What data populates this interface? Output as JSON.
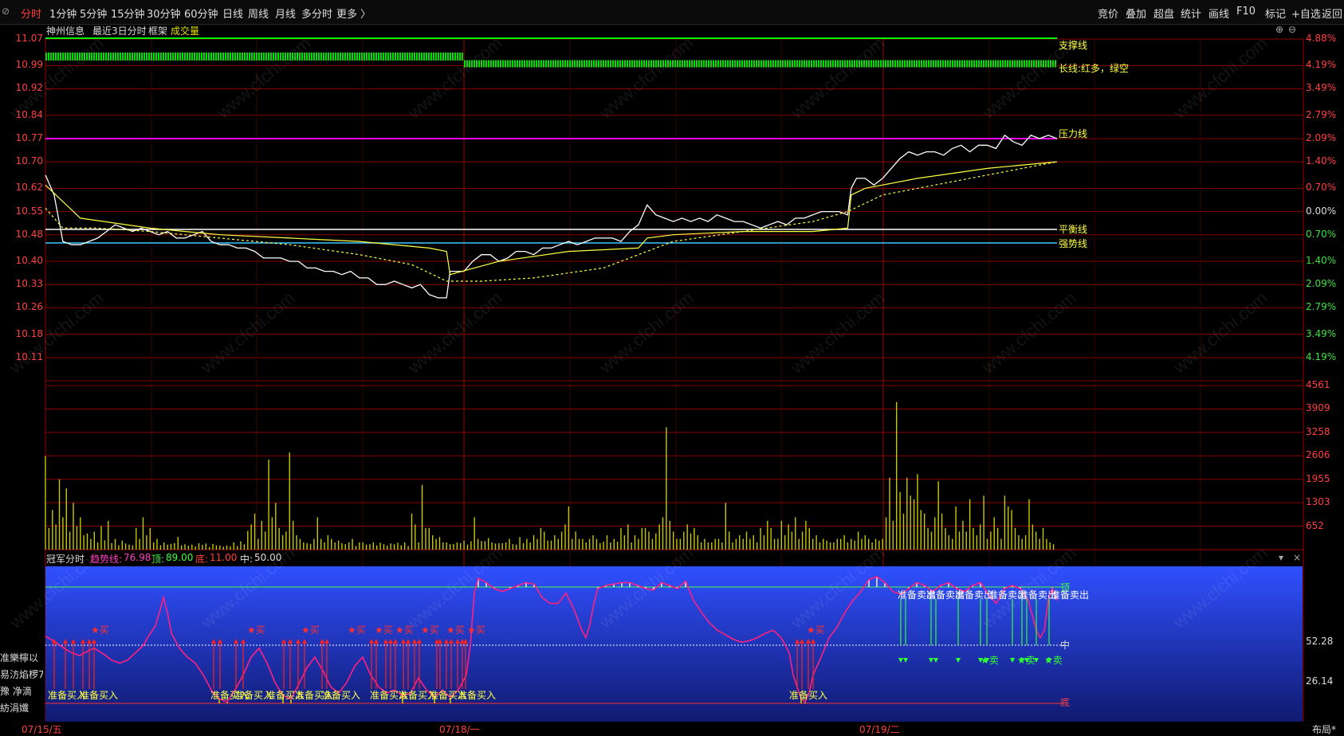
{
  "toolbar": {
    "left_icon": "⊘",
    "periods": [
      "分时",
      "1分钟",
      "5分钟",
      "15分钟",
      "30分钟",
      "60分钟",
      "日线",
      "周线",
      "月线",
      "多分时",
      "更多 〉"
    ],
    "active_period": "分时",
    "right_buttons": [
      "竞价",
      "叠加",
      "超盘",
      "统计",
      "画线",
      "F10",
      "标记",
      "+自选",
      "返回"
    ]
  },
  "info": {
    "stock": "神州信息",
    "range": "最近3日分时",
    "frame": "框架",
    "volume_label": "成交量"
  },
  "price_axis": {
    "left": [
      "11.07",
      "10.99",
      "10.92",
      "10.84",
      "10.77",
      "10.70",
      "10.62",
      "10.55",
      "10.48",
      "10.40",
      "10.33",
      "10.26",
      "10.18",
      "10.11"
    ],
    "right": [
      "4.88%",
      "4.19%",
      "3.49%",
      "2.79%",
      "2.09%",
      "1.40%",
      "0.70%",
      "0.00%",
      "0.70%",
      "1.40%",
      "2.09%",
      "2.79%",
      "3.49%",
      "4.19%"
    ]
  },
  "volume_axis": [
    "4561",
    "3909",
    "3258",
    "2606",
    "1955",
    "1303",
    "652"
  ],
  "line_labels": {
    "support": "支撑线",
    "long": "长线:红多，绿空",
    "pressure": "压力线",
    "balance": "平衡线",
    "strong": "强势线"
  },
  "indicator": {
    "name": "冠军分时",
    "trend_label": "趋势线:",
    "trend_value": "76.98",
    "top_label": "顶:",
    "top_value": "89.00",
    "bottom_label": "底:",
    "bottom_value": "11.00",
    "mid_label": "中:",
    "mid_value": "50.00",
    "axis": [
      "52.28",
      "26.14"
    ],
    "tag_top": "顶",
    "tag_mid": "中",
    "tag_bottom": "底",
    "buy_prep": "准备买入",
    "buy_star": "★买",
    "sell_prep": "准备卖出",
    "sell_star": "★卖"
  },
  "left_clips": [
    "准樂檸以",
    "易汸焰椤76",
    "豫  净滴",
    "紡涓孅"
  ],
  "dates": [
    "07/15/五",
    "07/18/一",
    "07/19/二"
  ],
  "footer_layout": "布局*",
  "watermark": "www.cfchi.com",
  "chart_data": {
    "type": "line",
    "price_ticks": [
      11.07,
      10.99,
      10.92,
      10.84,
      10.77,
      10.7,
      10.62,
      10.55,
      10.48,
      10.4,
      10.33,
      10.26,
      10.18,
      10.11
    ],
    "ylim": [
      10.04,
      11.11
    ],
    "prev_close": 10.55,
    "levels": {
      "support": 11.07,
      "pressure": 10.77,
      "balance": 10.485,
      "strong": 10.445
    },
    "price_series": [
      {
        "name": "price",
        "points": [
          [
            0,
            10.66
          ],
          [
            5,
            10.6
          ],
          [
            10,
            10.46
          ],
          [
            15,
            10.45
          ],
          [
            20,
            10.45
          ],
          [
            25,
            10.46
          ],
          [
            30,
            10.47
          ],
          [
            35,
            10.49
          ],
          [
            40,
            10.51
          ],
          [
            45,
            10.5
          ],
          [
            50,
            10.49
          ],
          [
            55,
            10.5
          ],
          [
            60,
            10.49
          ],
          [
            65,
            10.48
          ],
          [
            70,
            10.49
          ],
          [
            75,
            10.47
          ],
          [
            80,
            10.47
          ],
          [
            85,
            10.48
          ],
          [
            90,
            10.49
          ],
          [
            95,
            10.46
          ],
          [
            100,
            10.45
          ],
          [
            105,
            10.45
          ],
          [
            110,
            10.44
          ],
          [
            115,
            10.44
          ],
          [
            120,
            10.43
          ],
          [
            125,
            10.41
          ],
          [
            130,
            10.41
          ],
          [
            135,
            10.41
          ],
          [
            140,
            10.4
          ],
          [
            145,
            10.4
          ],
          [
            150,
            10.38
          ],
          [
            155,
            10.38
          ],
          [
            160,
            10.37
          ],
          [
            165,
            10.37
          ],
          [
            170,
            10.36
          ],
          [
            175,
            10.37
          ],
          [
            180,
            10.35
          ],
          [
            185,
            10.35
          ],
          [
            190,
            10.33
          ],
          [
            195,
            10.33
          ],
          [
            200,
            10.34
          ],
          [
            205,
            10.33
          ],
          [
            210,
            10.32
          ],
          [
            215,
            10.33
          ],
          [
            220,
            10.3
          ],
          [
            225,
            10.29
          ],
          [
            230,
            10.29
          ],
          [
            232,
            10.37
          ],
          [
            240,
            10.37
          ],
          [
            245,
            10.4
          ],
          [
            250,
            10.42
          ],
          [
            255,
            10.42
          ],
          [
            260,
            10.4
          ],
          [
            265,
            10.41
          ],
          [
            270,
            10.43
          ],
          [
            275,
            10.43
          ],
          [
            280,
            10.42
          ],
          [
            285,
            10.44
          ],
          [
            290,
            10.44
          ],
          [
            295,
            10.45
          ],
          [
            300,
            10.46
          ],
          [
            305,
            10.45
          ],
          [
            310,
            10.46
          ],
          [
            315,
            10.47
          ],
          [
            320,
            10.47
          ],
          [
            325,
            10.47
          ],
          [
            330,
            10.46
          ],
          [
            335,
            10.49
          ],
          [
            340,
            10.51
          ],
          [
            345,
            10.57
          ],
          [
            350,
            10.54
          ],
          [
            355,
            10.53
          ],
          [
            360,
            10.52
          ],
          [
            365,
            10.53
          ],
          [
            370,
            10.52
          ],
          [
            375,
            10.53
          ],
          [
            380,
            10.52
          ],
          [
            385,
            10.54
          ],
          [
            390,
            10.53
          ],
          [
            395,
            10.52
          ],
          [
            400,
            10.52
          ],
          [
            405,
            10.51
          ],
          [
            410,
            10.5
          ],
          [
            415,
            10.51
          ],
          [
            420,
            10.52
          ],
          [
            425,
            10.51
          ],
          [
            430,
            10.53
          ],
          [
            435,
            10.53
          ],
          [
            440,
            10.54
          ],
          [
            445,
            10.55
          ],
          [
            450,
            10.55
          ],
          [
            455,
            10.55
          ],
          [
            460,
            10.54
          ],
          [
            462,
            10.62
          ],
          [
            465,
            10.65
          ],
          [
            470,
            10.65
          ],
          [
            475,
            10.63
          ],
          [
            480,
            10.65
          ],
          [
            485,
            10.68
          ],
          [
            490,
            10.71
          ],
          [
            495,
            10.73
          ],
          [
            500,
            10.72
          ],
          [
            505,
            10.73
          ],
          [
            510,
            10.73
          ],
          [
            515,
            10.72
          ],
          [
            520,
            10.74
          ],
          [
            525,
            10.75
          ],
          [
            530,
            10.73
          ],
          [
            535,
            10.75
          ],
          [
            540,
            10.75
          ],
          [
            545,
            10.74
          ],
          [
            550,
            10.78
          ],
          [
            555,
            10.76
          ],
          [
            560,
            10.75
          ],
          [
            565,
            10.78
          ],
          [
            570,
            10.77
          ],
          [
            575,
            10.78
          ],
          [
            580,
            10.77
          ]
        ]
      },
      {
        "name": "avg",
        "points": [
          [
            0,
            10.63
          ],
          [
            20,
            10.53
          ],
          [
            60,
            10.5
          ],
          [
            100,
            10.48
          ],
          [
            140,
            10.47
          ],
          [
            180,
            10.46
          ],
          [
            220,
            10.44
          ],
          [
            230,
            10.43
          ],
          [
            232,
            10.36
          ],
          [
            260,
            10.4
          ],
          [
            300,
            10.43
          ],
          [
            340,
            10.44
          ],
          [
            345,
            10.47
          ],
          [
            360,
            10.48
          ],
          [
            400,
            10.49
          ],
          [
            440,
            10.49
          ],
          [
            460,
            10.5
          ],
          [
            462,
            10.6
          ],
          [
            470,
            10.62
          ],
          [
            500,
            10.65
          ],
          [
            540,
            10.68
          ],
          [
            580,
            10.7
          ]
        ]
      },
      {
        "name": "ma",
        "points": [
          [
            0,
            10.56
          ],
          [
            10,
            10.5
          ],
          [
            30,
            10.5
          ],
          [
            60,
            10.49
          ],
          [
            100,
            10.47
          ],
          [
            140,
            10.45
          ],
          [
            180,
            10.42
          ],
          [
            210,
            10.39
          ],
          [
            230,
            10.34
          ],
          [
            250,
            10.34
          ],
          [
            280,
            10.35
          ],
          [
            320,
            10.38
          ],
          [
            340,
            10.42
          ],
          [
            360,
            10.46
          ],
          [
            400,
            10.49
          ],
          [
            440,
            10.52
          ],
          [
            460,
            10.55
          ],
          [
            480,
            10.6
          ],
          [
            520,
            10.64
          ],
          [
            560,
            10.68
          ],
          [
            580,
            10.7
          ]
        ]
      }
    ],
    "volume_ticks": [
      4561,
      3909,
      3258,
      2606,
      1955,
      1303,
      652
    ],
    "volume_ylim": [
      0,
      4561
    ],
    "volume": [
      2600,
      600,
      1100,
      700,
      1950,
      900,
      1700,
      500,
      1300,
      650,
      900,
      400,
      450,
      300,
      500,
      200,
      650,
      260,
      800,
      180,
      300,
      120,
      250,
      170,
      140,
      120,
      600,
      300,
      900,
      400,
      600,
      200,
      300,
      120,
      200,
      140,
      160,
      180,
      350,
      120,
      150,
      110,
      140,
      90,
      180,
      130,
      170,
      70,
      160,
      120,
      110,
      80,
      120,
      90,
      200,
      100,
      230,
      150,
      520,
      700,
      1000,
      300,
      800,
      500,
      2500,
      900,
      1300,
      600,
      400,
      500,
      2700,
      800,
      400,
      300,
      200,
      180,
      160,
      300,
      900,
      300,
      200,
      400,
      300,
      200,
      250,
      180,
      150,
      200,
      300,
      100,
      200,
      200,
      140,
      150,
      200,
      120,
      190,
      150,
      110,
      170,
      150,
      190,
      120,
      200,
      100,
      1000,
      700,
      200,
      1800,
      600,
      600,
      400,
      300,
      350,
      200,
      200,
      150,
      160,
      200,
      180,
      250,
      140,
      230,
      900,
      300,
      240,
      240,
      320,
      200,
      170,
      180,
      180,
      200,
      300,
      150,
      140,
      350,
      180,
      300,
      200,
      400,
      300,
      600,
      500,
      250,
      250,
      400,
      300,
      500,
      700,
      1200,
      300,
      500,
      300,
      300,
      200,
      300,
      400,
      300,
      180,
      220,
      400,
      200,
      300,
      220,
      600,
      400,
      700,
      200,
      400,
      300,
      600,
      600,
      500,
      300,
      450,
      700,
      900,
      3400,
      800,
      500,
      300,
      300,
      500,
      700,
      450,
      600,
      400,
      200,
      300,
      200,
      200,
      300,
      300,
      200,
      1300,
      500,
      200,
      300,
      400,
      300,
      500,
      300,
      400,
      200,
      600,
      400,
      800,
      600,
      300,
      300,
      800,
      400,
      700,
      500,
      900,
      300,
      500,
      800,
      600,
      300,
      400,
      200,
      300,
      250,
      200,
      200,
      300,
      300,
      400,
      200,
      300,
      250,
      500,
      300,
      400,
      300,
      200,
      300,
      250,
      300,
      900,
      2000,
      800,
      4100,
      1600,
      1000,
      2000,
      1500,
      1400,
      2100,
      1100,
      1000,
      600,
      500,
      900,
      1900,
      1000,
      600,
      400,
      300,
      1200,
      500,
      800,
      500,
      1400,
      600,
      400,
      700,
      1500,
      300,
      500,
      900,
      600,
      300,
      1500,
      1200,
      1100,
      600,
      400,
      300,
      400,
      1400,
      700,
      500,
      300,
      600,
      300,
      200,
      150
    ],
    "indicator_series": {
      "name": "趋势线",
      "axis": [
        52.28,
        26.14
      ],
      "levels": {
        "top": 89.0,
        "mid": 50.0,
        "bottom": 11.0
      },
      "current": 76.98
    }
  }
}
